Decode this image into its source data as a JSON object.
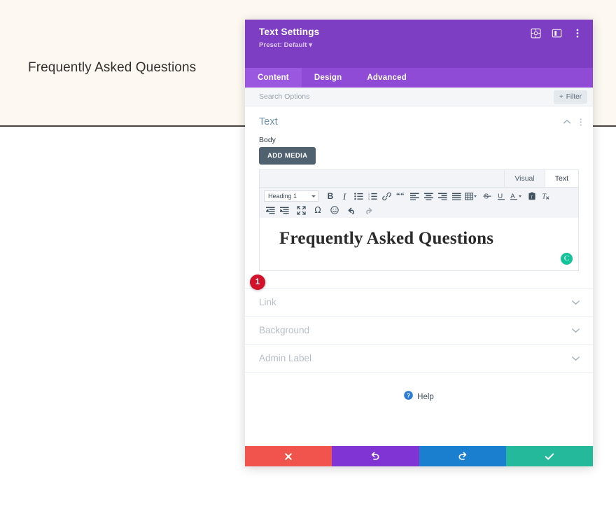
{
  "site": {
    "hero_title": "Frequently Asked Questions"
  },
  "modal": {
    "title": "Text Settings",
    "preset": "Preset: Default ▾",
    "header_icons": [
      {
        "name": "target-icon",
        "label": "Focus"
      },
      {
        "name": "layout-panel-icon",
        "label": "Layout"
      },
      {
        "name": "kebab-menu-icon",
        "label": "More options"
      }
    ],
    "tabs": [
      {
        "label": "Content",
        "active": true
      },
      {
        "label": "Design",
        "active": false
      },
      {
        "label": "Advanced",
        "active": false
      }
    ],
    "search": {
      "placeholder": "Search Options",
      "value": ""
    },
    "filter_label": "Filter",
    "section": {
      "title": "Text",
      "collapse_icon": "chevron-up-icon",
      "menu_icon": "kebab-menu-icon"
    },
    "field": {
      "label": "Body",
      "add_media_label": "ADD MEDIA"
    },
    "editor": {
      "view_tabs": [
        {
          "label": "Visual",
          "active": false
        },
        {
          "label": "Text",
          "active": true
        }
      ],
      "format_select": "Heading 1",
      "toolbar_row1": [
        {
          "name": "bold-icon",
          "glyph": "B"
        },
        {
          "name": "italic-icon",
          "glyph": "I"
        },
        {
          "name": "bulleted-list-icon",
          "glyph": ""
        },
        {
          "name": "numbered-list-icon",
          "glyph": ""
        },
        {
          "name": "link-icon",
          "glyph": ""
        },
        {
          "name": "blockquote-icon",
          "glyph": ""
        },
        {
          "name": "align-left-icon",
          "glyph": ""
        },
        {
          "name": "align-center-icon",
          "glyph": ""
        },
        {
          "name": "align-right-icon",
          "glyph": ""
        },
        {
          "name": "align-justify-icon",
          "glyph": ""
        },
        {
          "name": "table-icon",
          "glyph": ""
        },
        {
          "name": "strikethrough-icon",
          "glyph": "S"
        },
        {
          "name": "underline-icon",
          "glyph": "U"
        },
        {
          "name": "text-color-icon",
          "glyph": "A"
        },
        {
          "name": "paste-as-text-icon",
          "glyph": ""
        },
        {
          "name": "clear-formatting-icon",
          "glyph": ""
        }
      ],
      "toolbar_row2": [
        {
          "name": "outdent-icon",
          "glyph": ""
        },
        {
          "name": "indent-icon",
          "glyph": ""
        },
        {
          "name": "fullscreen-icon",
          "glyph": ""
        },
        {
          "name": "special-character-icon",
          "glyph": "Ω"
        },
        {
          "name": "emoji-icon",
          "glyph": ""
        },
        {
          "name": "undo-icon",
          "glyph": ""
        },
        {
          "name": "redo-icon",
          "glyph": ""
        }
      ],
      "content_heading": "Frequently Asked Questions",
      "assistant_badge": "C"
    },
    "step_badge": "1",
    "collapsed_sections": [
      {
        "label": "Link",
        "name": "link"
      },
      {
        "label": "Background",
        "name": "background"
      },
      {
        "label": "Admin Label",
        "name": "admin-label"
      }
    ],
    "help_label": "Help",
    "footer_buttons": [
      {
        "name": "cancel-button",
        "icon": "close-icon",
        "color": "#f0544c"
      },
      {
        "name": "undo-button",
        "icon": "undo-icon",
        "color": "#8034d4"
      },
      {
        "name": "redo-button",
        "icon": "redo-icon",
        "color": "#1b7fd0"
      },
      {
        "name": "save-button",
        "icon": "check-icon",
        "color": "#24b99a"
      }
    ]
  },
  "colors": {
    "modal_header": "#7e3ec3",
    "tabstrip": "#8f4bd6",
    "hero_bg": "#fdf9f2",
    "badge_red": "#d1122a",
    "assistant_green": "#15c39a"
  }
}
